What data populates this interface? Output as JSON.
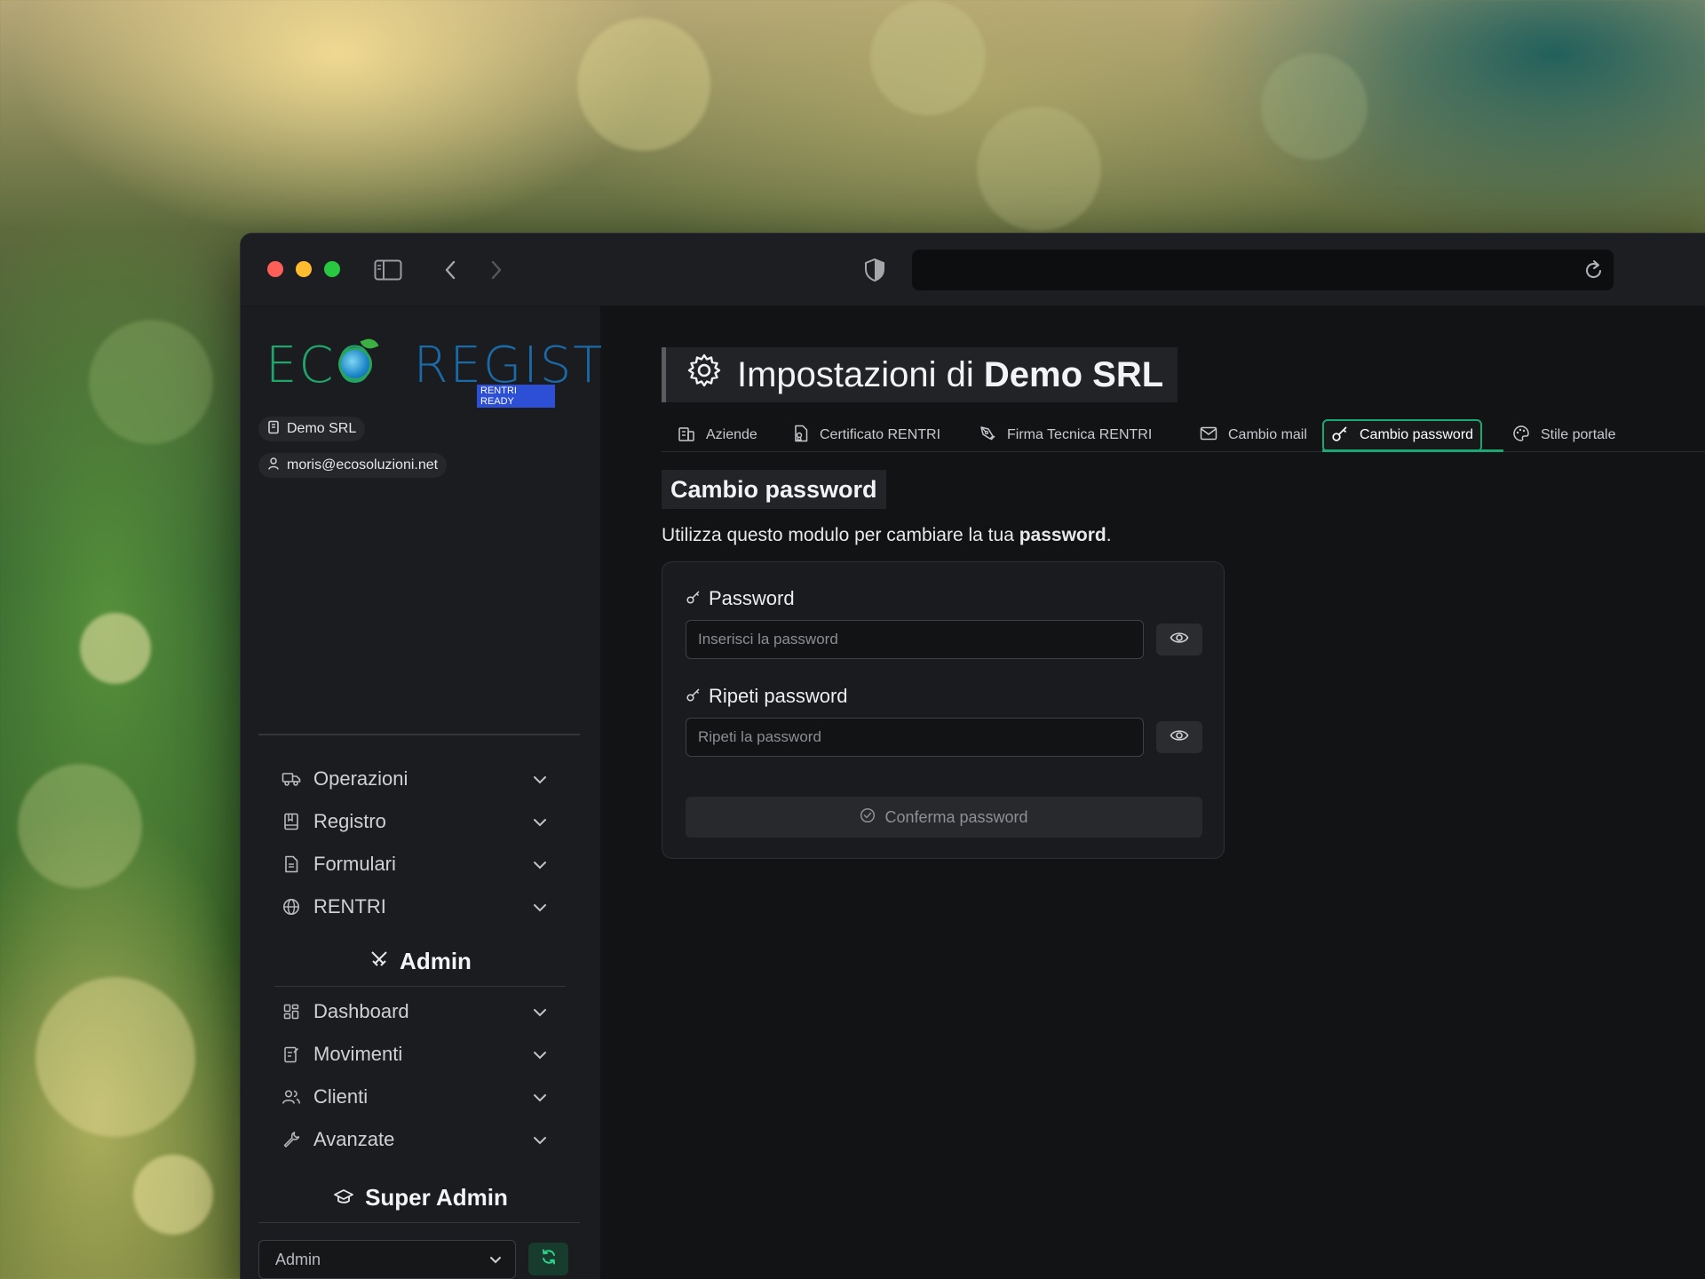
{
  "logo": {
    "text_left": "ECO",
    "text_right": "REGISTRI",
    "badge": "RENTRI READY"
  },
  "account": {
    "company": "Demo SRL",
    "email": "moris@ecosoluzioni.net"
  },
  "nav": [
    {
      "label": "Operazioni",
      "icon": "truck-icon"
    },
    {
      "label": "Registro",
      "icon": "book-icon"
    },
    {
      "label": "Formulari",
      "icon": "document-icon"
    },
    {
      "label": "RENTRI",
      "icon": "globe-icon"
    }
  ],
  "admin": {
    "title": "Admin",
    "items": [
      {
        "label": "Dashboard",
        "icon": "dashboard-icon"
      },
      {
        "label": "Movimenti",
        "icon": "edit-list-icon"
      },
      {
        "label": "Clienti",
        "icon": "users-icon"
      },
      {
        "label": "Avanzate",
        "icon": "wrench-icon"
      }
    ]
  },
  "super_admin": {
    "title": "Super Admin",
    "select_value": "Admin"
  },
  "page": {
    "title_prefix": "Impostazioni di",
    "title_company": "Demo SRL",
    "tabs": [
      {
        "label": "Aziende",
        "icon": "building-icon"
      },
      {
        "label": "Certificato RENTRI",
        "icon": "certificate-icon"
      },
      {
        "label": "Firma Tecnica RENTRI",
        "icon": "signature-icon"
      },
      {
        "label": "Cambio mail",
        "icon": "mail-icon"
      },
      {
        "label": "Cambio password",
        "icon": "key-icon",
        "active": true
      },
      {
        "label": "Stile portale",
        "icon": "palette-icon"
      }
    ],
    "section_heading": "Cambio password",
    "description_prefix": "Utilizza questo modulo per cambiare la tua ",
    "description_bold": "password",
    "description_suffix": ".",
    "form": {
      "password_label": "Password",
      "password_placeholder": "Inserisci la password",
      "repeat_label": "Ripeti password",
      "repeat_placeholder": "Ripeti la password",
      "confirm_label": "Conferma password"
    }
  },
  "colors": {
    "accent": "#1aa774",
    "window_bg": "#121315",
    "sidebar_bg": "#1b1c1f"
  }
}
